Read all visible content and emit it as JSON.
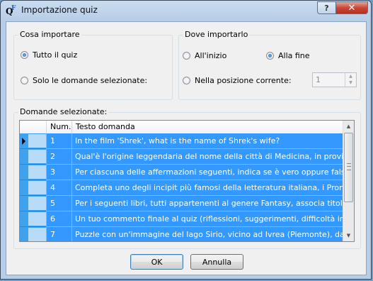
{
  "window": {
    "title": "Importazione quiz",
    "help_label": "?",
    "close_label": "✕"
  },
  "what_group": {
    "legend": "Cosa importare",
    "options": [
      {
        "label": "Tutto il quiz",
        "checked": true
      },
      {
        "label": "Solo le domande selezionate:",
        "checked": false
      }
    ]
  },
  "where_group": {
    "legend": "Dove importarlo",
    "options": [
      {
        "label": "All'inizio",
        "checked": false
      },
      {
        "label": "Alla fine",
        "checked": true
      },
      {
        "label": "Nella posizione corrente:",
        "checked": false
      }
    ],
    "position_value": "1"
  },
  "questions_group": {
    "legend": "Domande selezionate:",
    "columns": [
      "Num.",
      "Testo domanda"
    ],
    "rows": [
      {
        "num": "1",
        "text": "In the film 'Shrek', what is the name of Shrek's wife?"
      },
      {
        "num": "2",
        "text": "Qual'è l'origine leggendaria del nome della città di Medicina, in provincia di B..."
      },
      {
        "num": "3",
        "text": "Per ciascuna delle affermazioni seguenti, indica se è vero oppure falso"
      },
      {
        "num": "4",
        "text": " Completa uno degli incipit più famosi della letteratura italiana, i Promessi Spo..."
      },
      {
        "num": "5",
        "text": " Per i seguenti libri, tutti appartenenti al genere Fantasy, associa titolo del libr..."
      },
      {
        "num": "6",
        "text": "Un tuo commento finale al quiz (riflessioni, suggerimenti, difficoltà incontrate)"
      },
      {
        "num": "7",
        "text": "Puzzle con un'immagine del lago Sirio, vicino ad Ivrea (Piemonte), da ricomp..."
      }
    ]
  },
  "buttons": {
    "ok": "OK",
    "cancel": "Annulla"
  },
  "colors": {
    "selection": "#3399ff",
    "row_indicator": "#3fa2ef"
  }
}
